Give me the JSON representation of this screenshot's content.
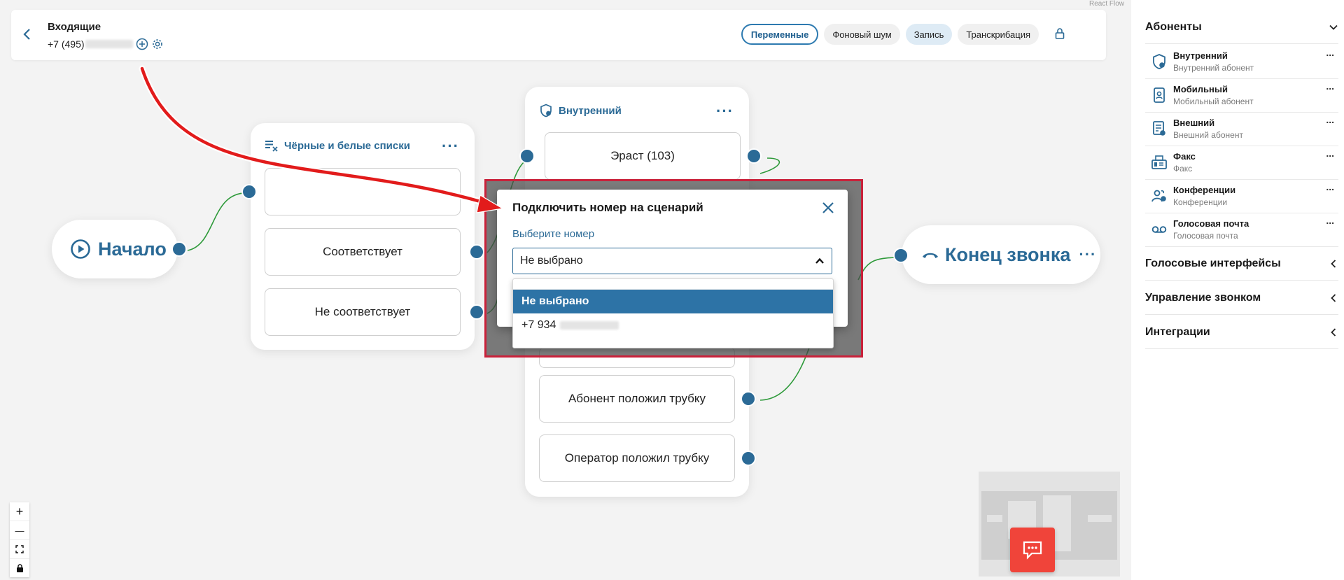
{
  "flow_label": "React Flow",
  "header": {
    "title": "Входящие",
    "phone": "+7 (495)",
    "buttons": {
      "variables": "Переменные",
      "noise": "Фоновый шум",
      "record": "Запись",
      "transcribe": "Транскрибация"
    }
  },
  "nodes": {
    "start": {
      "label": "Начало"
    },
    "lists": {
      "title": "Чёрные и белые списки",
      "options": [
        "",
        "Соответствует",
        "Не соответствует"
      ]
    },
    "internal": {
      "title": "Внутренний",
      "operator": "Эраст (103)",
      "options": [
        "Абонент положил трубку",
        "Оператор положил трубку"
      ]
    },
    "end": {
      "label": "Конец звонка"
    }
  },
  "modal": {
    "title": "Подключить номер на сценарий",
    "field_label": "Выберите номер",
    "selected": "Не выбрано",
    "options": [
      "Не выбрано",
      "+7 934"
    ]
  },
  "zoom": {
    "plus": "+",
    "minus": "—"
  },
  "sidebar": {
    "subscribers": {
      "title": "Абоненты",
      "items": [
        {
          "name": "Внутренний",
          "sub": "Внутренний абонент",
          "icon": "shield-user-icon"
        },
        {
          "name": "Мобильный",
          "sub": "Мобильный абонент",
          "icon": "mobile-icon"
        },
        {
          "name": "Внешний",
          "sub": "Внешний абонент",
          "icon": "external-icon"
        },
        {
          "name": "Факс",
          "sub": "Факс",
          "icon": "fax-icon"
        },
        {
          "name": "Конференции",
          "sub": "Конференции",
          "icon": "conference-icon"
        },
        {
          "name": "Голосовая почта",
          "sub": "Голосовая почта",
          "icon": "voicemail-icon"
        }
      ],
      "item_menu": "..."
    },
    "sections": [
      "Голосовые интерфейсы",
      "Управление звонком",
      "Интеграции"
    ]
  },
  "colors": {
    "accent": "#2b6a96",
    "edge": "#2e9a3a",
    "chat": "#f0443a",
    "highlight_border": "#c9213a",
    "arrow": "#e21b1b"
  }
}
